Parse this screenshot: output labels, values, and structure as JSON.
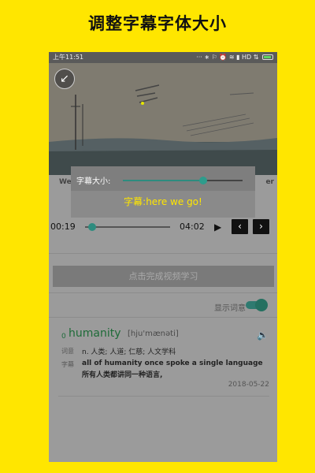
{
  "promo": {
    "title": "调整字幕字体大小"
  },
  "status_bar": {
    "time": "上午11:51",
    "icons": "··· ∗ ⚐ ⏰ ≋ ▮ HD ⇅",
    "network": "HD"
  },
  "video": {
    "back_icon": "back-arrow-icon"
  },
  "behind_text": {
    "left": "We",
    "right": "er"
  },
  "subtitle_settings": {
    "size_label": "字幕大小:",
    "size_level": 0.67,
    "preview_text": "字幕:here we go!",
    "preview_color": "#FFE600",
    "accent_color": "#2E9C8C"
  },
  "player": {
    "current_time": "00:19",
    "total_time": "04:02",
    "progress": 0.08,
    "play_icon": "▶",
    "prev_icon": "‹",
    "next_icon": "›"
  },
  "complete_button": {
    "label": "点击完成视频学习"
  },
  "definition_toggle": {
    "label": "显示词意",
    "on": true
  },
  "word_card": {
    "index": "0",
    "word": "humanity",
    "phonetic": "[hju'mænəti]",
    "meaning_label": "词意",
    "meaning": "n. 人类; 人道; 仁慈; 人文学科",
    "subtitle_label": "字幕",
    "subtitle_en": "all of humanity once spoke a single language",
    "subtitle_zh": "所有人类都讲同一种语言,",
    "date": "2018-05-22",
    "speaker_icon": "🔈"
  }
}
